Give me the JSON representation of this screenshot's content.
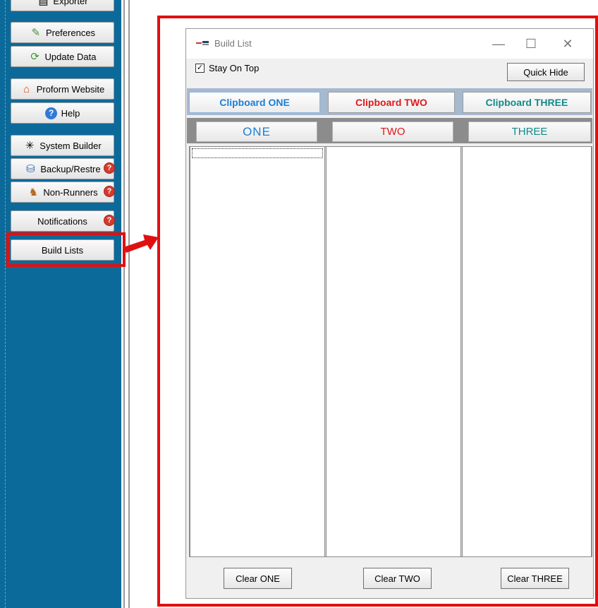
{
  "sidebar": {
    "items": [
      {
        "label": "Exporter",
        "icon": "exporter-icon",
        "badge": ""
      },
      {
        "label": "Preferences",
        "icon": "preferences-icon",
        "badge": ""
      },
      {
        "label": "Update Data",
        "icon": "refresh-icon",
        "badge": ""
      },
      {
        "label": "Proform Website",
        "icon": "home-icon",
        "badge": ""
      },
      {
        "label": "Help",
        "icon": "help-icon",
        "badge": ""
      },
      {
        "label": "System Builder",
        "icon": "spinner-icon",
        "badge": ""
      },
      {
        "label": "Backup/Restre",
        "icon": "backup-icon",
        "badge": "?"
      },
      {
        "label": "Non-Runners",
        "icon": "horse-icon",
        "badge": "?"
      },
      {
        "label": "Notifications",
        "icon": "notifications-icon",
        "badge": "?"
      },
      {
        "label": "Build Lists",
        "icon": "",
        "badge": ""
      }
    ]
  },
  "dialog": {
    "title": "Build List",
    "controls": {
      "minimize": "—",
      "maximize": "☐",
      "close": "✕"
    },
    "stay_on_top": {
      "label": "Stay On Top",
      "checked": true,
      "mark": "✓"
    },
    "quick_hide": "Quick Hide",
    "clipboard_tabs": [
      {
        "label": "Clipboard ONE",
        "color": "#1a7fd6"
      },
      {
        "label": "Clipboard TWO",
        "color": "#e01818"
      },
      {
        "label": "Clipboard THREE",
        "color": "#138a8a"
      }
    ],
    "column_labels": [
      {
        "label": "ONE",
        "color": "#1a7fd6"
      },
      {
        "label": "TWO",
        "color": "#e01818"
      },
      {
        "label": "THREE",
        "color": "#138a8a"
      }
    ],
    "clear_buttons": [
      "Clear ONE",
      "Clear TWO",
      "Clear THREE"
    ]
  },
  "colors": {
    "sidebar_bg": "#0b6a9a",
    "highlight": "#e01010"
  }
}
